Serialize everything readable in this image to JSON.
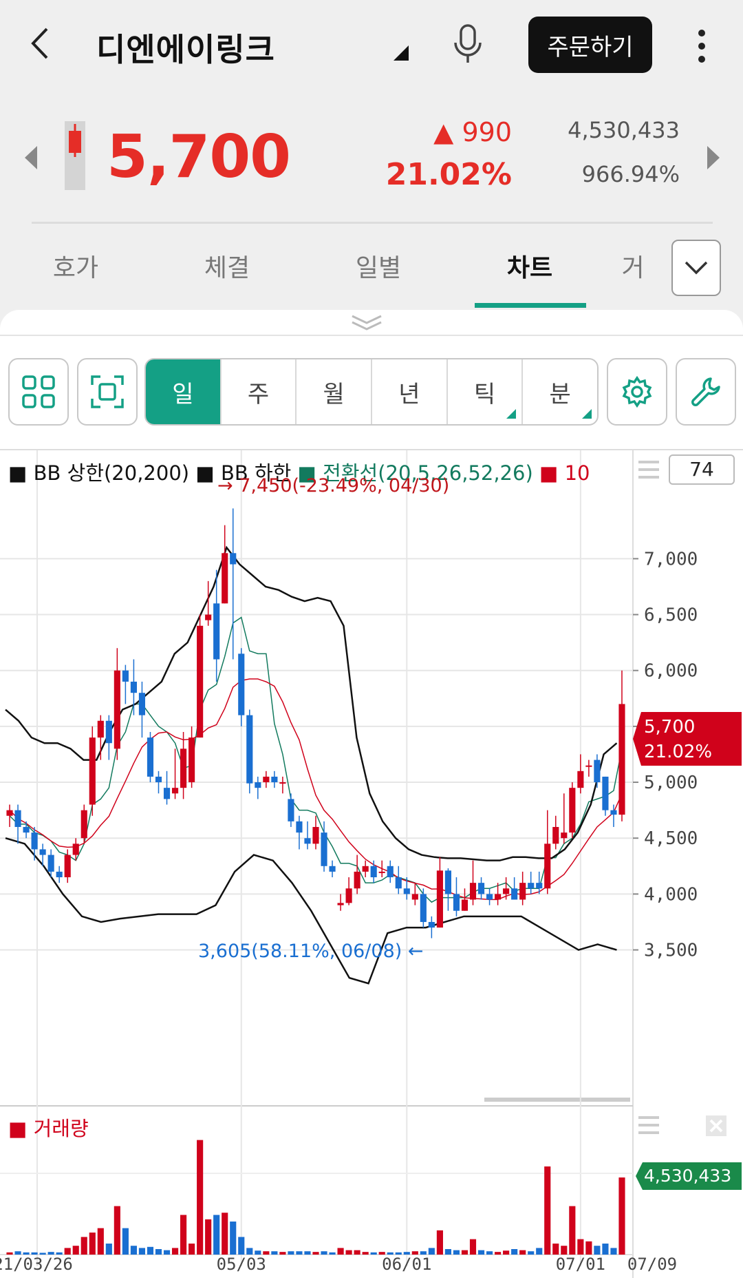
{
  "header": {
    "title": "디엔에이링크",
    "order_label": "주문하기"
  },
  "quote": {
    "price": "5,700",
    "change": "▲ 990",
    "change_pct": "21.02%",
    "volume": "4,530,433",
    "volume_pct": "966.94%"
  },
  "tabs": [
    {
      "label": "호가"
    },
    {
      "label": "체결"
    },
    {
      "label": "일별"
    },
    {
      "label": "차트"
    },
    {
      "label": "거"
    }
  ],
  "periods": [
    {
      "label": "일"
    },
    {
      "label": "주"
    },
    {
      "label": "월"
    },
    {
      "label": "년"
    },
    {
      "label": "틱"
    },
    {
      "label": "분"
    }
  ],
  "legend": {
    "bb_upper": "BB 상한(20,200)",
    "bb_lower": "BB 하한",
    "conv": "전환선(20,5,26,52,26)",
    "ten": "10",
    "count": "74",
    "volume": "거래량"
  },
  "annotations": {
    "high": "→ 7,450(-23.49%, 04/30)",
    "low": "3,605(58.11%, 06/08) ←"
  },
  "badges": {
    "price": "5,700",
    "pct": "21.02%",
    "volume": "4,530,433"
  },
  "colors": {
    "up": "#d0021b",
    "down": "#1a6fd1",
    "accent": "#14a085",
    "volume_badge": "#1a8a4a"
  },
  "chart_data": {
    "type": "candlestick",
    "y_ticks": [
      "7,000",
      "6,500",
      "6,000",
      "5,500",
      "5,000",
      "4,500",
      "4,000",
      "3,500"
    ],
    "x_ticks": [
      "21/03/26",
      "05/03",
      "06/01",
      "07/01",
      "07/09"
    ],
    "ylim": [
      3300,
      7600
    ],
    "candles": [
      [
        4700,
        4750,
        4600,
        4800
      ],
      [
        4750,
        4600,
        4450,
        4800
      ],
      [
        4600,
        4550,
        4500,
        4650
      ],
      [
        4550,
        4400,
        4300,
        4600
      ],
      [
        4400,
        4350,
        4250,
        4450
      ],
      [
        4350,
        4200,
        4150,
        4400
      ],
      [
        4200,
        4150,
        4100,
        4250
      ],
      [
        4150,
        4350,
        4100,
        4400
      ],
      [
        4350,
        4450,
        4300,
        4500
      ],
      [
        4500,
        4750,
        4450,
        4800
      ],
      [
        4800,
        5400,
        4700,
        5500
      ],
      [
        5400,
        5550,
        5200,
        5600
      ],
      [
        5550,
        5350,
        5200,
        5600
      ],
      [
        5300,
        6000,
        5200,
        6200
      ],
      [
        6000,
        5900,
        5700,
        6050
      ],
      [
        5900,
        5800,
        5600,
        6100
      ],
      [
        5800,
        5600,
        5400,
        5900
      ],
      [
        5400,
        5050,
        5000,
        5450
      ],
      [
        5050,
        5000,
        4900,
        5100
      ],
      [
        4950,
        4850,
        4800,
        5100
      ],
      [
        4900,
        4950,
        4850,
        5300
      ],
      [
        4950,
        5300,
        4850,
        5450
      ],
      [
        5000,
        5400,
        4950,
        5500
      ],
      [
        5400,
        6400,
        5400,
        6500
      ],
      [
        6450,
        6500,
        6400,
        6800
      ],
      [
        6600,
        6100,
        5900,
        6900
      ],
      [
        6600,
        7050,
        6600,
        7300
      ],
      [
        7050,
        6950,
        6100,
        7450
      ],
      [
        6150,
        5600,
        5500,
        6200
      ],
      [
        5600,
        4990,
        4900,
        5650
      ],
      [
        5000,
        4950,
        4850,
        5050
      ],
      [
        5000,
        5050,
        4950,
        5100
      ],
      [
        5050,
        5000,
        4950,
        5100
      ],
      [
        5000,
        5000,
        4900,
        5050
      ],
      [
        4850,
        4650,
        4600,
        4900
      ],
      [
        4650,
        4550,
        4400,
        4700
      ],
      [
        4500,
        4450,
        4400,
        4650
      ],
      [
        4450,
        4600,
        4400,
        4700
      ],
      [
        4550,
        4250,
        4200,
        4650
      ],
      [
        4250,
        4200,
        4150,
        4300
      ],
      [
        3900,
        3920,
        3850,
        4000
      ],
      [
        3920,
        4050,
        3900,
        4150
      ],
      [
        4050,
        4200,
        4000,
        4350
      ],
      [
        4200,
        4250,
        4150,
        4300
      ],
      [
        4250,
        4150,
        4100,
        4300
      ],
      [
        4200,
        4200,
        4150,
        4300
      ],
      [
        4250,
        4150,
        4100,
        4300
      ],
      [
        4150,
        4050,
        4000,
        4250
      ],
      [
        4050,
        4000,
        3950,
        4150
      ],
      [
        3950,
        4000,
        3900,
        4100
      ],
      [
        4000,
        3750,
        3700,
        4050
      ],
      [
        3750,
        3700,
        3605,
        3800
      ],
      [
        3700,
        4210,
        3700,
        4330
      ],
      [
        4210,
        4000,
        3850,
        4230
      ],
      [
        4000,
        3850,
        3800,
        4150
      ],
      [
        3850,
        3950,
        3850,
        4050
      ],
      [
        3950,
        4100,
        3900,
        4300
      ],
      [
        4100,
        4000,
        3950,
        4150
      ],
      [
        4000,
        3950,
        3900,
        4050
      ],
      [
        3950,
        4000,
        3900,
        4100
      ],
      [
        4000,
        4050,
        3950,
        4150
      ],
      [
        4050,
        3950,
        3950,
        4150
      ],
      [
        3950,
        4100,
        3900,
        4200
      ],
      [
        4100,
        4050,
        4000,
        4200
      ],
      [
        4100,
        4050,
        4000,
        4200
      ],
      [
        4050,
        4450,
        4000,
        4750
      ],
      [
        4450,
        4600,
        4400,
        4700
      ],
      [
        4500,
        4550,
        4450,
        4900
      ],
      [
        4550,
        4950,
        4500,
        5000
      ],
      [
        4950,
        5100,
        4900,
        5250
      ],
      [
        5150,
        5150,
        5050,
        5200
      ],
      [
        5200,
        5000,
        4950,
        5250
      ],
      [
        5050,
        4750,
        4700,
        5050
      ],
      [
        4750,
        4710,
        4600,
        4800
      ],
      [
        4710,
        5700,
        4650,
        6000
      ]
    ],
    "volume_max": 5000000,
    "volumes": [
      100000,
      150000,
      100000,
      100000,
      80000,
      120000,
      100000,
      300000,
      400000,
      800000,
      1000000,
      1200000,
      500000,
      2200000,
      1200000,
      400000,
      300000,
      350000,
      250000,
      200000,
      300000,
      1800000,
      500000,
      5200000,
      1600000,
      1800000,
      1900000,
      1500000,
      800000,
      300000,
      180000,
      150000,
      150000,
      120000,
      150000,
      150000,
      150000,
      120000,
      150000,
      100000,
      300000,
      200000,
      200000,
      120000,
      100000,
      120000,
      100000,
      100000,
      120000,
      150000,
      150000,
      300000,
      1100000,
      250000,
      200000,
      200000,
      700000,
      200000,
      150000,
      120000,
      180000,
      250000,
      200000,
      150000,
      300000,
      4000000,
      500000,
      400000,
      2200000,
      700000,
      600000,
      400000,
      500000,
      300000,
      3500000
    ],
    "bb_upper": [
      [
        0,
        5650
      ],
      [
        1,
        5550
      ],
      [
        2,
        5400
      ],
      [
        3,
        5350
      ],
      [
        4,
        5350
      ],
      [
        5,
        5300
      ],
      [
        6,
        5200
      ],
      [
        7,
        5200
      ],
      [
        8,
        5450
      ],
      [
        9,
        5650
      ],
      [
        10,
        5700
      ],
      [
        11,
        5800
      ],
      [
        12,
        5900
      ],
      [
        13,
        6150
      ],
      [
        14,
        6250
      ],
      [
        15,
        6500
      ],
      [
        16,
        6750
      ],
      [
        17,
        7100
      ],
      [
        18,
        6950
      ],
      [
        19,
        6850
      ],
      [
        20,
        6750
      ],
      [
        21,
        6720
      ],
      [
        22,
        6660
      ],
      [
        23,
        6620
      ],
      [
        24,
        6650
      ],
      [
        25,
        6620
      ],
      [
        26,
        6400
      ],
      [
        27,
        5400
      ],
      [
        28,
        4900
      ],
      [
        29,
        4650
      ],
      [
        30,
        4500
      ],
      [
        31,
        4400
      ],
      [
        32,
        4350
      ],
      [
        33,
        4330
      ],
      [
        34,
        4320
      ],
      [
        35,
        4320
      ],
      [
        36,
        4310
      ],
      [
        37,
        4300
      ],
      [
        38,
        4300
      ],
      [
        39,
        4330
      ],
      [
        40,
        4330
      ],
      [
        41,
        4320
      ],
      [
        42,
        4320
      ],
      [
        43,
        4400
      ],
      [
        44,
        4550
      ],
      [
        45,
        4800
      ],
      [
        46,
        5250
      ],
      [
        47,
        5350
      ]
    ],
    "bb_lower": [
      [
        0,
        4500
      ],
      [
        1,
        4450
      ],
      [
        2,
        4250
      ],
      [
        3,
        4000
      ],
      [
        4,
        3800
      ],
      [
        5,
        3750
      ],
      [
        6,
        3780
      ],
      [
        7,
        3800
      ],
      [
        8,
        3820
      ],
      [
        9,
        3820
      ],
      [
        10,
        3820
      ],
      [
        11,
        3900
      ],
      [
        12,
        4200
      ],
      [
        13,
        4350
      ],
      [
        14,
        4300
      ],
      [
        15,
        4100
      ],
      [
        16,
        3850
      ],
      [
        17,
        3550
      ],
      [
        18,
        3250
      ],
      [
        19,
        3200
      ],
      [
        20,
        3650
      ],
      [
        21,
        3700
      ],
      [
        22,
        3700
      ],
      [
        23,
        3750
      ],
      [
        24,
        3800
      ],
      [
        25,
        3800
      ],
      [
        26,
        3800
      ],
      [
        27,
        3800
      ],
      [
        28,
        3700
      ],
      [
        29,
        3600
      ],
      [
        30,
        3500
      ],
      [
        31,
        3550
      ],
      [
        32,
        3500
      ]
    ],
    "x_positions": {
      "bb_upper": [
        8,
        20,
        35,
        50,
        62,
        75,
        86,
        100,
        118,
        134,
        150,
        165,
        180,
        197,
        214,
        232,
        252,
        268,
        300,
        330,
        355,
        368,
        383,
        395,
        405,
        415,
        425,
        440,
        460,
        480,
        500,
        520,
        540,
        560,
        580,
        600,
        620,
        640,
        660,
        680,
        700,
        715,
        730,
        745,
        760,
        775,
        790,
        800
      ]
    }
  }
}
